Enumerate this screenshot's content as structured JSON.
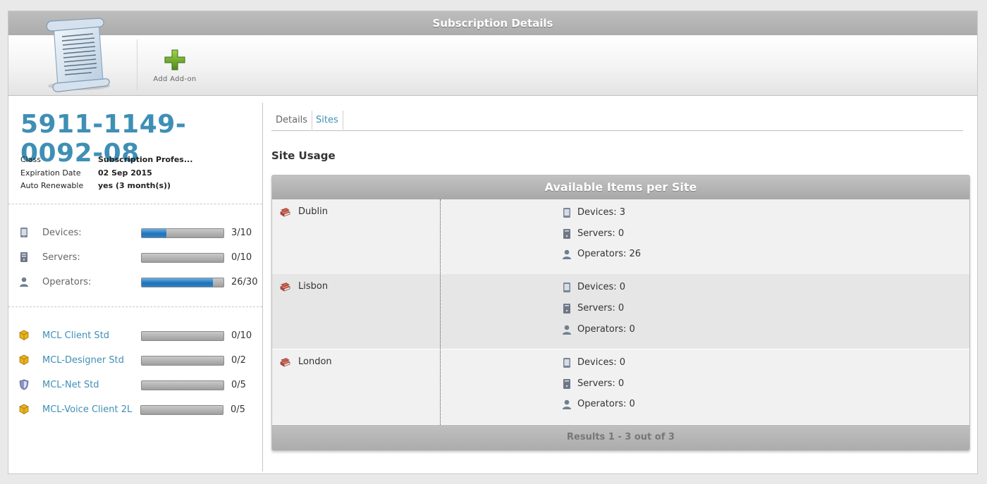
{
  "window": {
    "title": "Subscription Details"
  },
  "toolbar": {
    "add_addon_label": "Add Add-on"
  },
  "subscription": {
    "number": "5911-1149-0092-08",
    "info": [
      {
        "key": "Class",
        "value": "Subscription Profes..."
      },
      {
        "key": "Expiration Date",
        "value": "02 Sep 2015"
      },
      {
        "key": "Auto Renewable",
        "value": "yes (3 month(s))"
      }
    ]
  },
  "usage": [
    {
      "name": "Devices:",
      "value": "3/10",
      "fraction": 0.3,
      "icon": "device-icon"
    },
    {
      "name": "Servers:",
      "value": "0/10",
      "fraction": 0,
      "icon": "server-icon"
    },
    {
      "name": "Operators:",
      "value": "26/30",
      "fraction": 0.867,
      "icon": "operator-icon"
    }
  ],
  "addons": [
    {
      "name": "MCL Client Std",
      "value": "0/10",
      "fraction": 0,
      "icon": "package-icon"
    },
    {
      "name": "MCL-Designer Std",
      "value": "0/2",
      "fraction": 0,
      "icon": "package-icon"
    },
    {
      "name": "MCL-Net Std",
      "value": "0/5",
      "fraction": 0,
      "icon": "shield-icon"
    },
    {
      "name": "MCL-Voice Client 2L",
      "value": "0/5",
      "fraction": 0,
      "icon": "package-icon"
    }
  ],
  "tabs": [
    {
      "label": "Details",
      "active": false
    },
    {
      "label": "Sites",
      "active": true
    }
  ],
  "site_usage": {
    "title": "Site Usage",
    "grid_title": "Available Items per Site",
    "sites": [
      {
        "name": "Dublin",
        "devices": "Devices: 3",
        "servers": "Servers: 0",
        "operators": "Operators: 26"
      },
      {
        "name": "Lisbon",
        "devices": "Devices: 0",
        "servers": "Servers: 0",
        "operators": "Operators: 0"
      },
      {
        "name": "London",
        "devices": "Devices: 0",
        "servers": "Servers: 0",
        "operators": "Operators: 0"
      }
    ],
    "footer": "Results 1 - 3 out of 3"
  },
  "colors": {
    "link": "#3f8fb5",
    "bar_fill": "#1e73bb",
    "header_gray": "#b0b0b0"
  }
}
